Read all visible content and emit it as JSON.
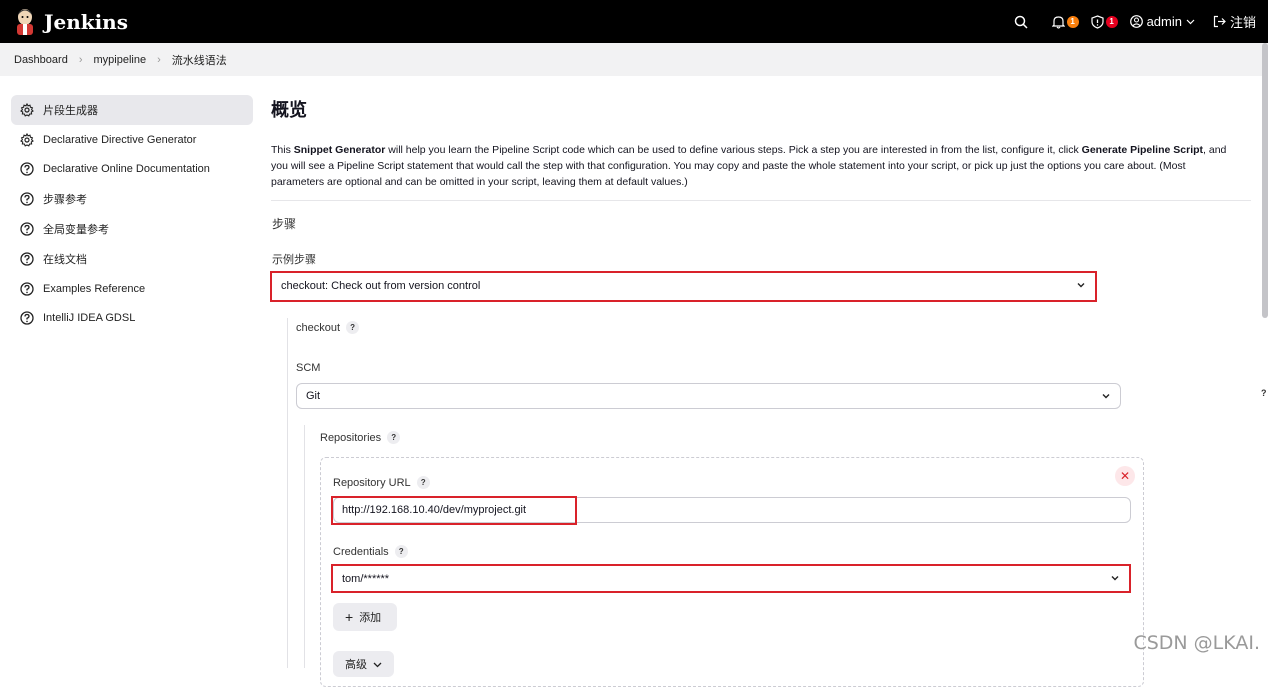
{
  "header": {
    "brand": "Jenkins",
    "notifications_count": "1",
    "security_count": "1",
    "user": "admin",
    "logout_label": "注销"
  },
  "breadcrumb": [
    "Dashboard",
    "mypipeline",
    "流水线语法"
  ],
  "sidebar": {
    "items": [
      {
        "label": "片段生成器",
        "icon": "gear-icon"
      },
      {
        "label": "Declarative Directive Generator",
        "icon": "gear-icon"
      },
      {
        "label": "Declarative Online Documentation",
        "icon": "help-circle-icon"
      },
      {
        "label": "步骤参考",
        "icon": "help-circle-icon"
      },
      {
        "label": "全局变量参考",
        "icon": "help-circle-icon"
      },
      {
        "label": "在线文档",
        "icon": "help-circle-icon"
      },
      {
        "label": "Examples Reference",
        "icon": "help-circle-icon"
      },
      {
        "label": "IntelliJ IDEA GDSL",
        "icon": "help-circle-icon"
      }
    ]
  },
  "main": {
    "title": "概览",
    "desc_1": "This ",
    "desc_b1": "Snippet Generator",
    "desc_2": " will help you learn the Pipeline Script code which can be used to define various steps. Pick a step you are interested in from the list, configure it, click ",
    "desc_b2": "Generate Pipeline Script",
    "desc_3": ", and you will see a Pipeline Script statement that would call the step with that configuration. You may copy and paste the whole statement into your script, or pick up just the options you care about. (Most parameters are optional and can be omitted in your script, leaving them at default values.)",
    "steps_heading": "步骤",
    "sample_step_label": "示例步骤",
    "sample_step_value": "checkout: Check out from version control",
    "checkout_label": "checkout",
    "scm_label": "SCM",
    "scm_value": "Git",
    "repositories_label": "Repositories",
    "repo_url_label": "Repository URL",
    "repo_url_value": "http://192.168.10.40/dev/myproject.git",
    "credentials_label": "Credentials",
    "credentials_value": "tom/******",
    "add_button": "添加",
    "advanced_button": "高级"
  },
  "watermark": "CSDN @LKAI."
}
